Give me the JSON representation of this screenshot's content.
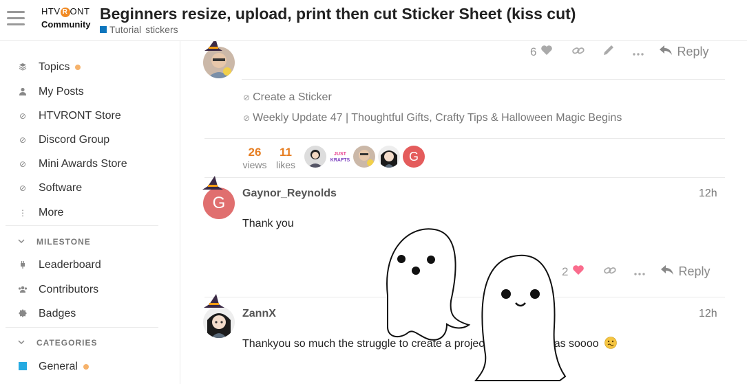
{
  "header": {
    "logo_brand_left": "HTV",
    "logo_brand_r": "R",
    "logo_brand_right": "ONT",
    "logo_sub": "Community",
    "title": "Beginners resize, upload, print then cut Sticker Sheet (kiss cut)",
    "category": "Tutorial",
    "tag": "stickers",
    "category_color": "#0e76bd"
  },
  "sidebar": {
    "items": [
      {
        "label": "Topics",
        "icon": "layers-icon"
      },
      {
        "label": "My Posts",
        "icon": "user-icon"
      },
      {
        "label": "HTVRONT Store",
        "icon": "link-icon"
      },
      {
        "label": "Discord Group",
        "icon": "link-icon"
      },
      {
        "label": "Mini Awards Store",
        "icon": "link-icon"
      },
      {
        "label": "Software",
        "icon": "link-icon"
      },
      {
        "label": "More",
        "icon": "ellipsis-vertical-icon"
      }
    ],
    "milestone_header": "MILESTONE",
    "milestone_items": [
      {
        "label": "Leaderboard",
        "icon": "plug-icon"
      },
      {
        "label": "Contributors",
        "icon": "users-icon"
      },
      {
        "label": "Badges",
        "icon": "badge-icon"
      }
    ],
    "categories_header": "CATEGORIES",
    "category_items": [
      {
        "label": "General",
        "color": "#25aae1"
      }
    ]
  },
  "first_post": {
    "like_count": "6",
    "reply_label": "Reply",
    "links": [
      "Create a Sticker",
      "Weekly Update 47 | Thoughtful Gifts, Crafty Tips & Halloween Magic Begins"
    ],
    "views_count": "26",
    "views_label": "views",
    "likes_count": "11",
    "likes_label": "likes",
    "participant_initial": "G",
    "participant_text_logo_line1": "JUST",
    "participant_text_logo_line2": "KRAFTS"
  },
  "posts": [
    {
      "avatar_initial": "G",
      "username": "Gaynor_Reynolds",
      "time": "12h",
      "body": "Thank you",
      "like_count": "2",
      "reply_label": "Reply"
    },
    {
      "username": "ZannX",
      "time": "12h",
      "body": "Thankyou so much the struggle to create a project under 5mb was soooo"
    }
  ],
  "accent": "#e67e22",
  "like_color": "#fa6c8d"
}
